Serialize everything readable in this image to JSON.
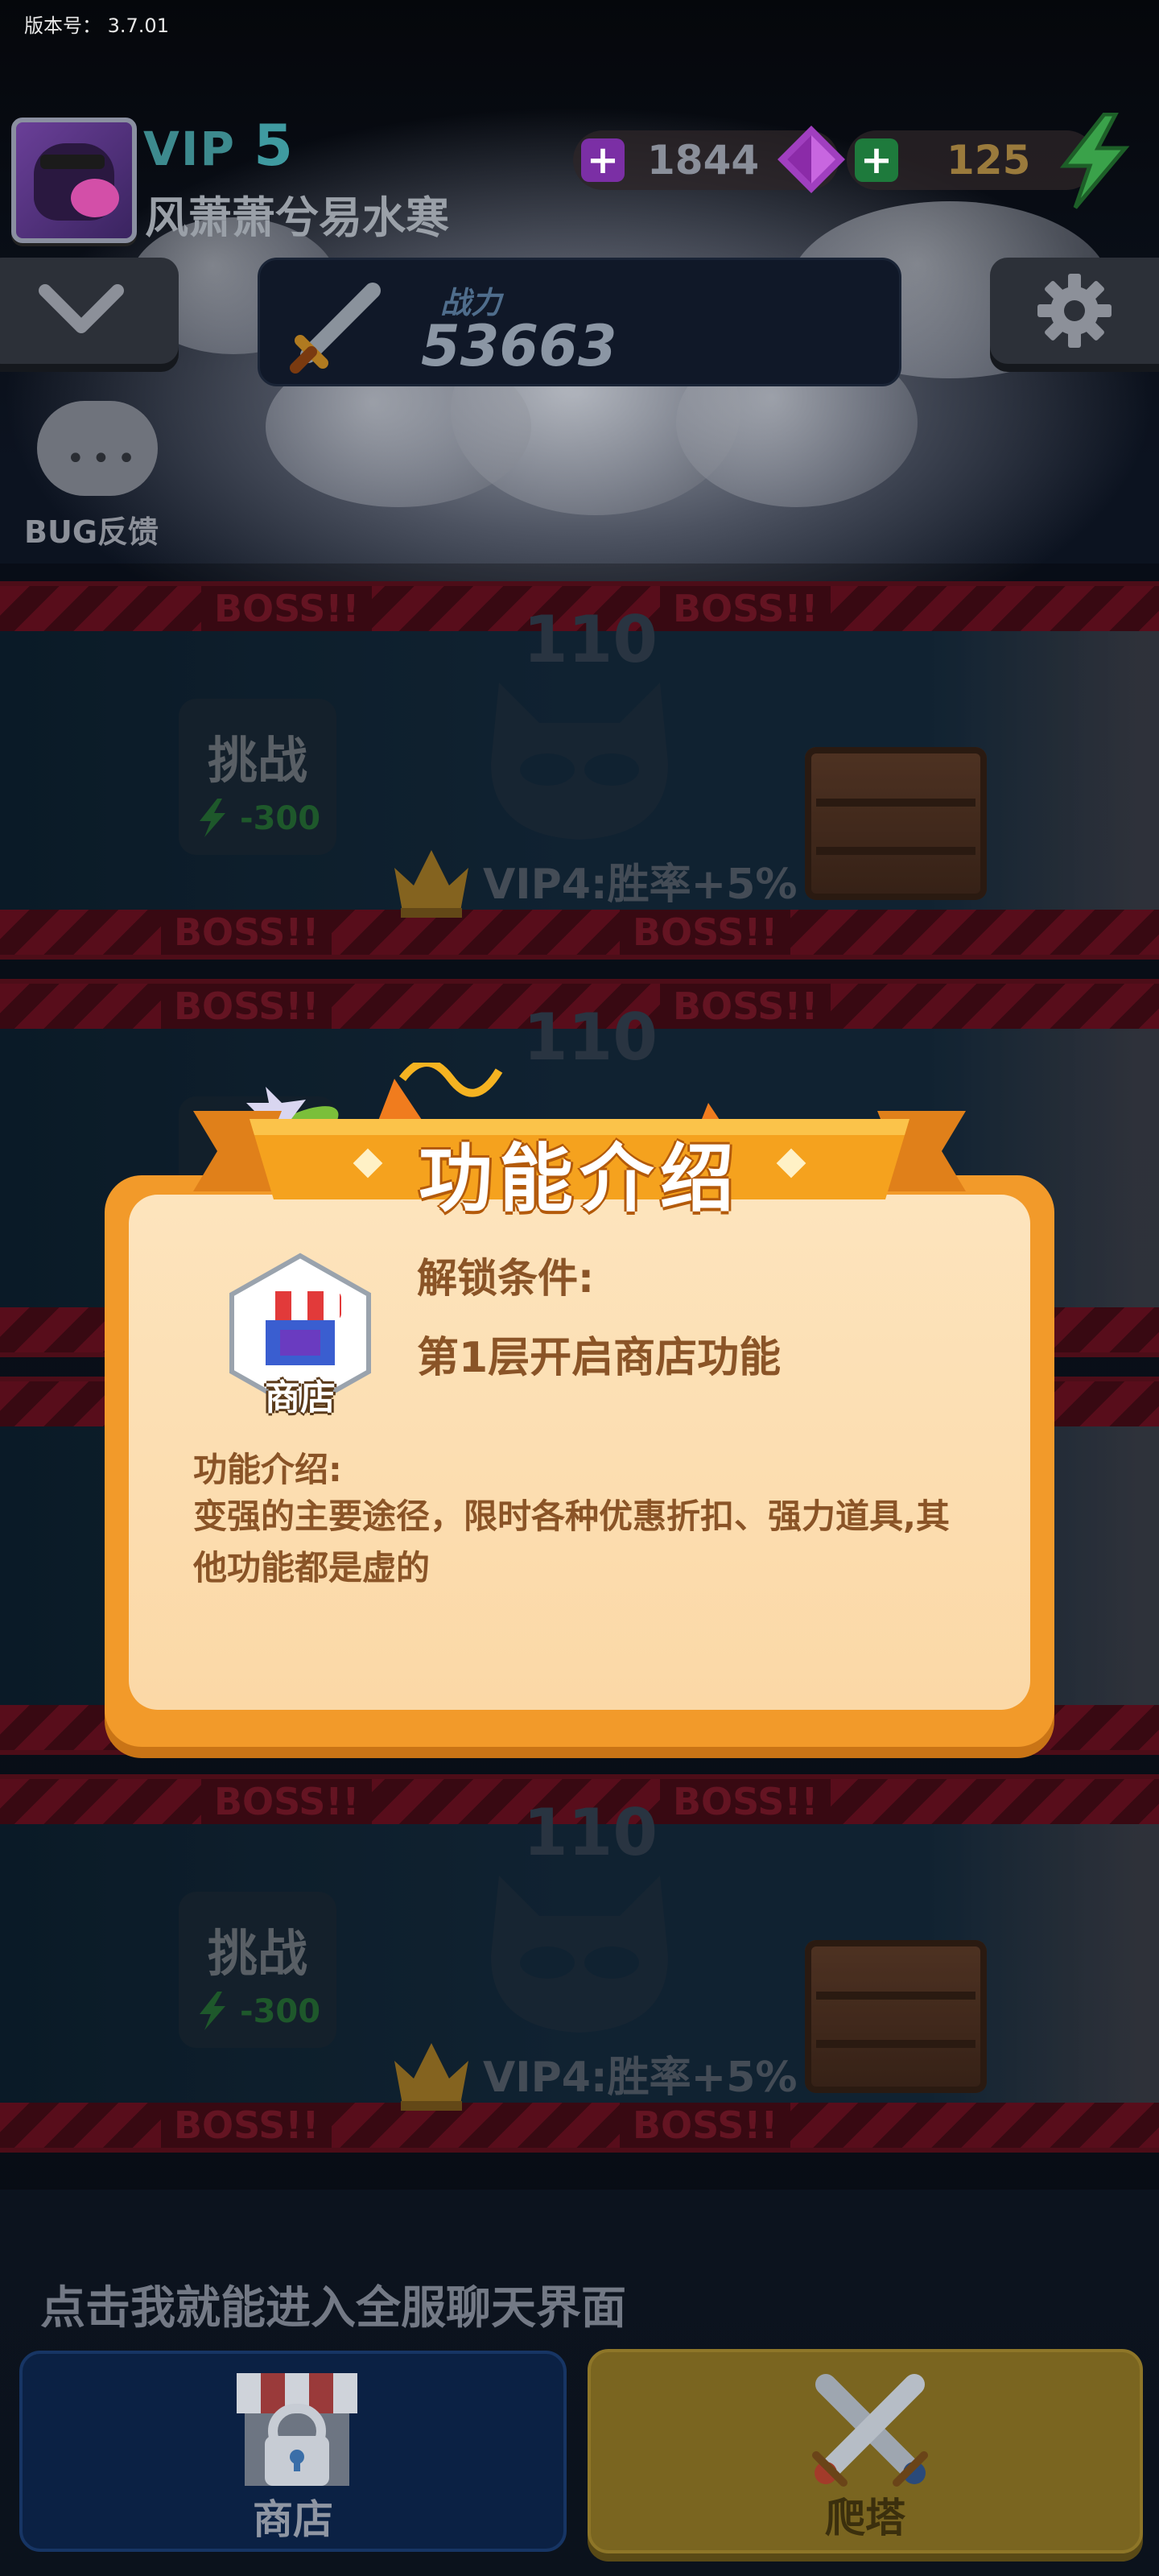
{
  "app": {
    "version": "版本号：  3.7.01"
  },
  "player": {
    "vip_prefix": "VIP",
    "vip_level": "5",
    "name": "风萧萧兮易水寒",
    "gems": "1844",
    "energy": "125"
  },
  "power": {
    "label": "战力",
    "value": "53663"
  },
  "bug_feedback": {
    "label": "BUG反馈",
    "icon": "chat-bubble-icon"
  },
  "floors": [
    {
      "floor": "110",
      "boss_tag": "BOSS!!",
      "challenge_label": "挑战",
      "cost": "-300",
      "bonus": "VIP4:胜率+5%"
    },
    {
      "floor": "110",
      "boss_tag": "BOSS!!"
    },
    {
      "floor": "",
      "boss_tag": ""
    },
    {
      "floor": "110",
      "boss_tag": "BOSS!!",
      "challenge_label": "挑战",
      "cost": "-300",
      "bonus": "VIP4:胜率+5%"
    }
  ],
  "popup": {
    "title": "功能介绍",
    "icon_label": "商店",
    "unlock_label": "解锁条件:",
    "unlock_condition": "第1层开启商店功能",
    "intro_label": "功能介绍:",
    "intro_text": "变强的主要途径，限时各种优惠折扣、强力道具,其他功能都是虚的"
  },
  "chat": {
    "tip": "点击我就能进入全服聊天界面"
  },
  "bottom_nav": {
    "shop_label": "商店",
    "tower_label": "爬塔"
  },
  "colors": {
    "popup_orange": "#f29a2a",
    "popup_cream": "#fde4bd",
    "popup_text": "#8a5427",
    "boss_red": "#7a1226",
    "tower_gold": "#7a6520",
    "shop_blue": "#0b2144"
  }
}
